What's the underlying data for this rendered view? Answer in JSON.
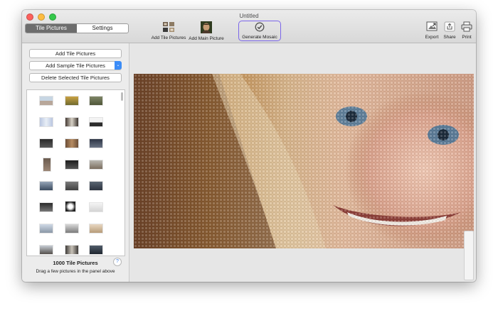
{
  "window": {
    "title": "Untitled"
  },
  "tabs": [
    {
      "label": "Tile Pictures",
      "active": true
    },
    {
      "label": "Settings",
      "active": false
    }
  ],
  "toolbar": {
    "add_tile_pictures": "Add Tile Pictures",
    "add_main_picture": "Add Main Picture",
    "generate_mosaic": "Generate Mosaic",
    "export": "Export",
    "share": "Share",
    "print": "Print",
    "accent_color": "#7b66ea"
  },
  "left_panel": {
    "add_tile_btn": "Add Tile Pictures",
    "add_sample_btn": "Add Sample Tile Pictures",
    "delete_btn": "Delete Selected Tile Pictures",
    "tile_count": "1000 Tile Pictures",
    "help": "?",
    "hint": "Drag a few pictures in the panel above"
  }
}
